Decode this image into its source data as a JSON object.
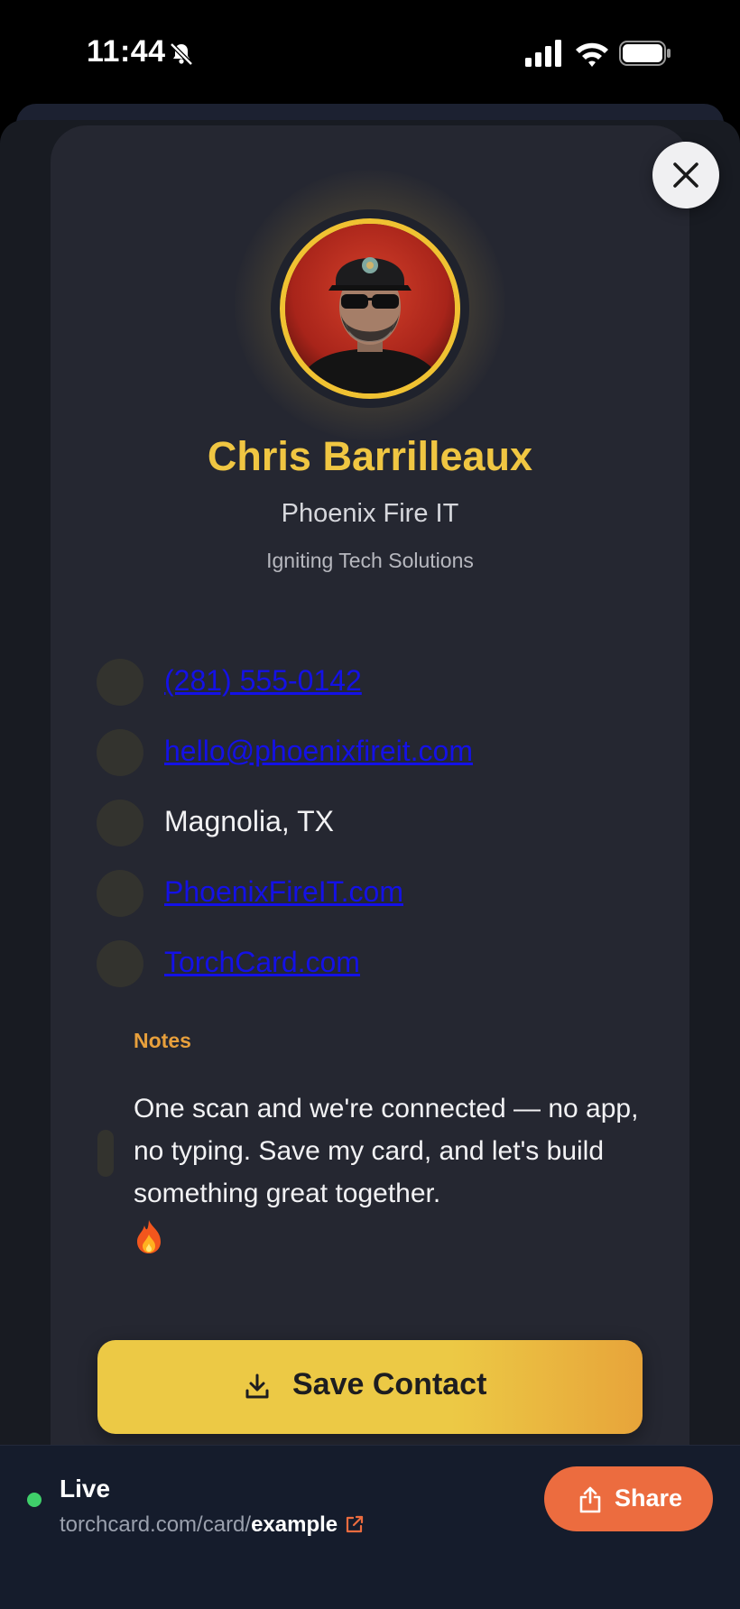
{
  "status_bar": {
    "time": "11:44"
  },
  "profile": {
    "name": "Chris Barrilleaux",
    "company": "Phoenix Fire IT",
    "tagline": "Igniting Tech Solutions"
  },
  "contacts": [
    {
      "icon": "phone-icon",
      "text": "(281) 555-0142"
    },
    {
      "icon": "email-icon",
      "text": "hello@phoenixfireit.com"
    },
    {
      "icon": "location-icon",
      "text": "Magnolia, TX"
    },
    {
      "icon": "website-icon",
      "text": "PhoenixFireIT.com"
    },
    {
      "icon": "website-icon",
      "text": "TorchCard.com"
    }
  ],
  "notes": {
    "label": "Notes",
    "text": "One scan and we're connected — no app, no typing. Save my card, and let's build something great together."
  },
  "save_button": {
    "label": "Save Contact"
  },
  "bottom_bar": {
    "status": "Live",
    "url_prefix": "torchcard.com/card/",
    "url_slug": "example",
    "share_label": "Share"
  },
  "colors": {
    "accent_gold": "#f0c642",
    "notes_orange": "#e8a03c",
    "share_orange": "#ec6c3f",
    "live_green": "#3fcf6a",
    "link_blue": "#1411e6"
  }
}
